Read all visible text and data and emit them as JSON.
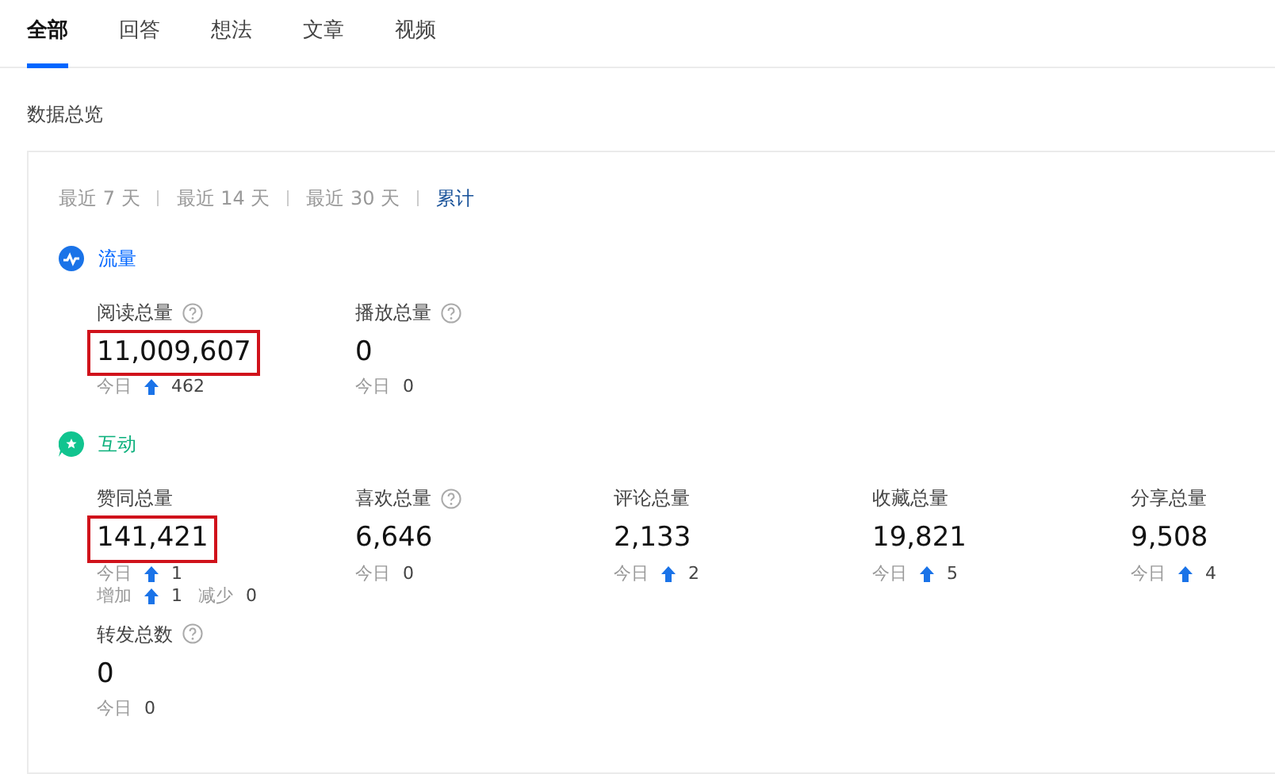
{
  "tabs": [
    {
      "label": "全部",
      "selected": true
    },
    {
      "label": "回答",
      "selected": false
    },
    {
      "label": "想法",
      "selected": false
    },
    {
      "label": "文章",
      "selected": false
    },
    {
      "label": "视频",
      "selected": false
    }
  ],
  "overview_title": "数据总览",
  "ranges": [
    {
      "label": "最近 7 天",
      "selected": false
    },
    {
      "label": "最近 14 天",
      "selected": false
    },
    {
      "label": "最近 30 天",
      "selected": false
    },
    {
      "label": "累计",
      "selected": true
    }
  ],
  "sections": [
    {
      "title": "流量",
      "kind": "traffic",
      "metrics": [
        {
          "label": "阅读总量",
          "help": true,
          "value": "11,009,607",
          "highlighted": true,
          "lines": [
            [
              {
                "label": "今日",
                "up": true,
                "value": "462"
              }
            ]
          ]
        },
        {
          "label": "播放总量",
          "help": true,
          "value": "0",
          "highlighted": false,
          "lines": [
            [
              {
                "label": "今日",
                "up": false,
                "value": "0"
              }
            ]
          ]
        }
      ]
    },
    {
      "title": "互动",
      "kind": "interaction",
      "metrics": [
        {
          "label": "赞同总量",
          "help": false,
          "value": "141,421",
          "highlighted": true,
          "lines": [
            [
              {
                "label": "今日",
                "up": true,
                "value": "1"
              }
            ],
            [
              {
                "label": "增加",
                "up": true,
                "value": "1"
              },
              {
                "label": "减少",
                "up": false,
                "value": "0"
              }
            ]
          ]
        },
        {
          "label": "喜欢总量",
          "help": true,
          "value": "6,646",
          "highlighted": false,
          "lines": [
            [
              {
                "label": "今日",
                "up": false,
                "value": "0"
              }
            ]
          ]
        },
        {
          "label": "评论总量",
          "help": false,
          "value": "2,133",
          "highlighted": false,
          "lines": [
            [
              {
                "label": "今日",
                "up": true,
                "value": "2"
              }
            ]
          ]
        },
        {
          "label": "收藏总量",
          "help": false,
          "value": "19,821",
          "highlighted": false,
          "lines": [
            [
              {
                "label": "今日",
                "up": true,
                "value": "5"
              }
            ]
          ]
        },
        {
          "label": "分享总量",
          "help": false,
          "value": "9,508",
          "highlighted": false,
          "lines": [
            [
              {
                "label": "今日",
                "up": true,
                "value": "4"
              }
            ]
          ]
        },
        {
          "label": "转发总数",
          "help": true,
          "value": "0",
          "highlighted": false,
          "lines": [
            [
              {
                "label": "今日",
                "up": false,
                "value": "0"
              }
            ]
          ]
        }
      ]
    }
  ]
}
